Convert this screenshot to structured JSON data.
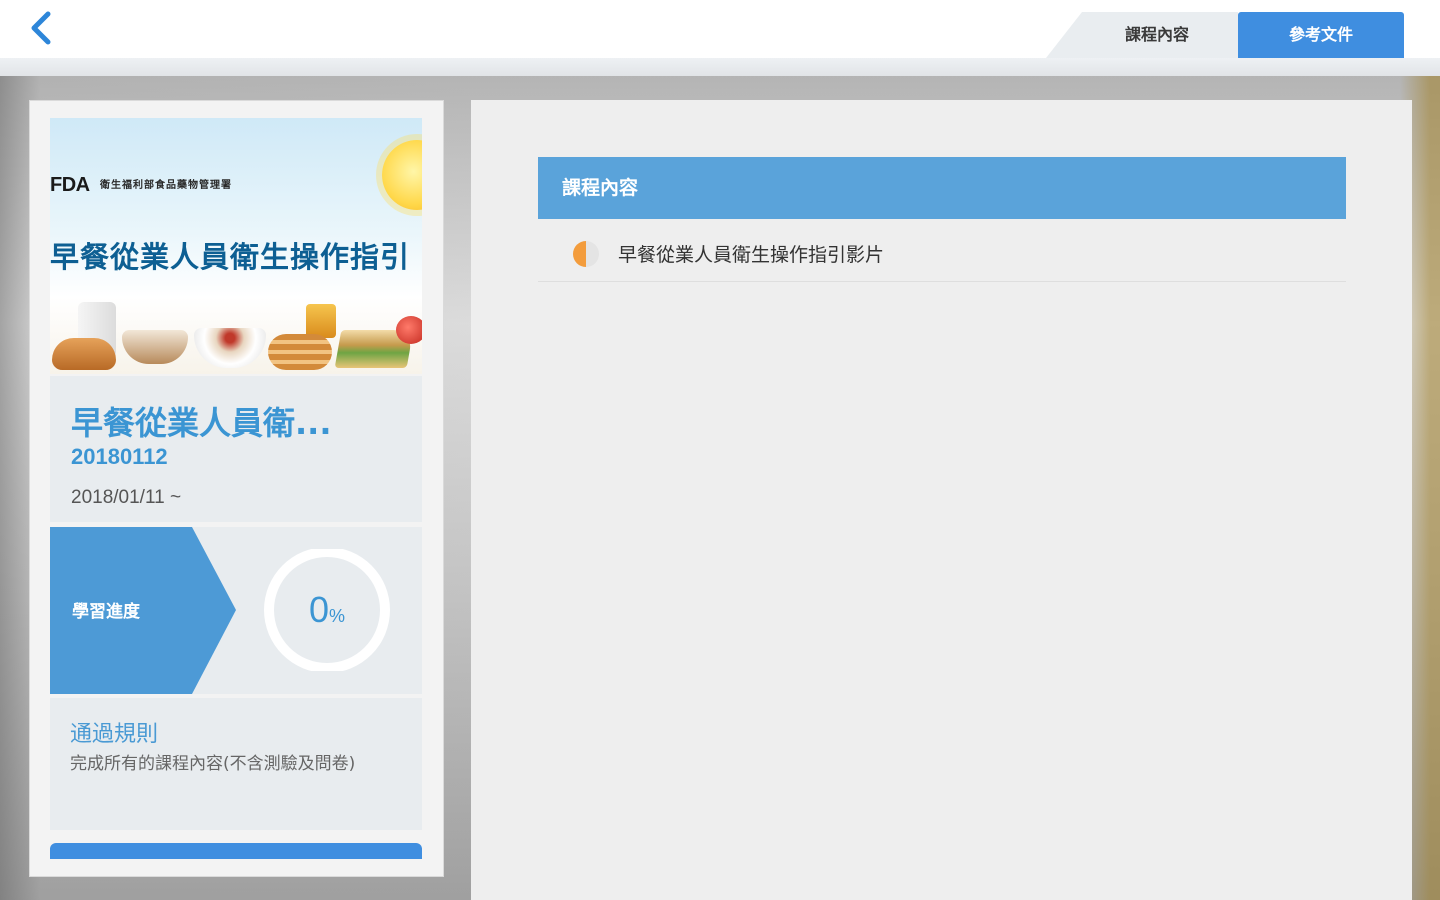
{
  "header": {
    "tabs": [
      {
        "label": "課程內容",
        "active": false
      },
      {
        "label": "參考文件",
        "active": true
      }
    ]
  },
  "course": {
    "banner": {
      "logo": "FDA",
      "agency": "衛生福利部食品藥物管理署",
      "title": "早餐從業人員衛生操作指引"
    },
    "title": "早餐從業人員衛...",
    "code": "20180112",
    "date": "2018/01/11 ~",
    "progress": {
      "label": "學習進度",
      "value": "0",
      "unit": "%",
      "fraction": 0
    },
    "rules": {
      "title": "通過規則",
      "text": "完成所有的課程內容(不含測驗及問卷)"
    }
  },
  "content": {
    "section_title": "課程內容",
    "items": [
      {
        "label": "早餐從業人員衛生操作指引影片",
        "status": "in-progress"
      }
    ]
  },
  "colors": {
    "accent": "#3f8ee0",
    "section_header": "#5aa3da",
    "title_text": "#3b95d3",
    "status_dot": "#f39c3c"
  }
}
